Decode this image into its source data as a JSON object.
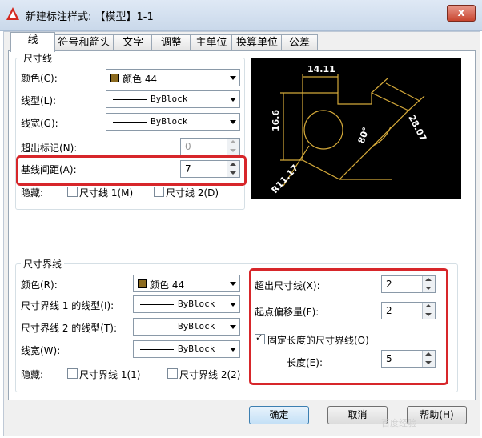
{
  "window": {
    "title": "新建标注样式: 【模型】1-1",
    "close_label": "x"
  },
  "tabs": [
    "线",
    "符号和箭头",
    "文字",
    "调整",
    "主单位",
    "换算单位",
    "公差"
  ],
  "dim_line": {
    "legend": "尺寸线",
    "color_label": "颜色(C):",
    "color_value": "颜色 44",
    "linetype_label": "线型(L):",
    "linetype_value": "ByBlock",
    "lineweight_label": "线宽(G):",
    "lineweight_value": "ByBlock",
    "extend_label": "超出标记(N):",
    "extend_value": "0",
    "baseline_label": "基线间距(A):",
    "baseline_value": "7",
    "suppress_label": "隐藏:",
    "suppress1": "尺寸线 1(M)",
    "suppress2": "尺寸线 2(D)"
  },
  "ext_line": {
    "legend": "尺寸界线",
    "color_label": "颜色(R):",
    "color_value": "颜色 44",
    "lt1_label": "尺寸界线 1 的线型(I):",
    "lt1_value": "ByBlock",
    "lt2_label": "尺寸界线 2 的线型(T):",
    "lt2_value": "ByBlock",
    "lw_label": "线宽(W):",
    "lw_value": "ByBlock",
    "suppress_label": "隐藏:",
    "suppress1": "尺寸界线 1(1)",
    "suppress2": "尺寸界线 2(2)",
    "beyond_label": "超出尺寸线(X):",
    "beyond_value": "2",
    "offset_label": "起点偏移量(F):",
    "offset_value": "2",
    "fixed_label": "固定长度的尺寸界线(O)",
    "fixed_checked": true,
    "length_label": "长度(E):",
    "length_value": "5"
  },
  "preview": {
    "dim_top": "14.11",
    "dim_left": "16.6",
    "dim_right": "28.07",
    "dim_angle": "80°",
    "dim_radius": "R11.17"
  },
  "buttons": {
    "ok": "确定",
    "cancel": "取消",
    "help": "帮助(H)"
  },
  "watermark": "百度经验",
  "colors": {
    "swatch": "#8b6a1f",
    "highlight": "#d7262a",
    "preview_line": "#d4a93a"
  }
}
